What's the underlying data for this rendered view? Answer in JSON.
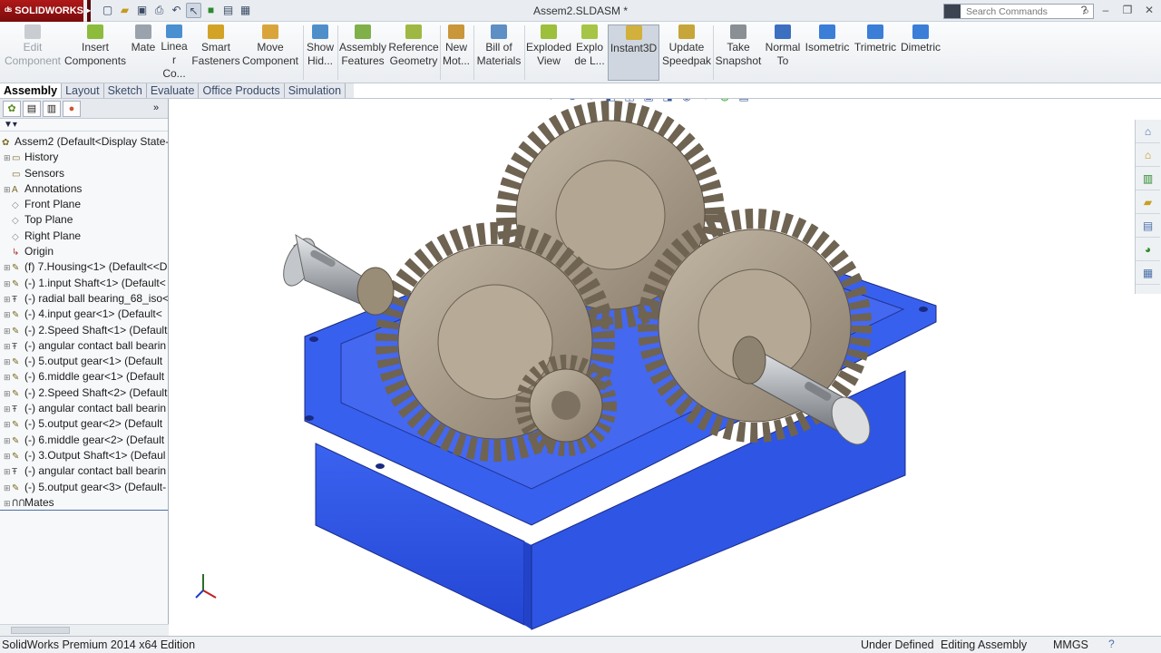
{
  "app": {
    "brand": "SOLIDWORKS",
    "doc_title": "Assem2.SLDASM *"
  },
  "search": {
    "placeholder": "Search Commands"
  },
  "ribbon": {
    "edit_component": [
      "Edit",
      "Component"
    ],
    "insert_components": [
      "Insert",
      "Components"
    ],
    "mate": "Mate",
    "linear_pattern": [
      "Linea",
      "r Co..."
    ],
    "smart_fasteners": [
      "Smart",
      "Fasteners"
    ],
    "move_component": [
      "Move",
      "Component"
    ],
    "show_hidden": [
      "Show",
      "Hid..."
    ],
    "assembly_features": [
      "Assembly",
      "Features"
    ],
    "reference_geometry": [
      "Reference",
      "Geometry"
    ],
    "new_motion": [
      "New",
      "Mot..."
    ],
    "bill_of_materials": [
      "Bill of",
      "Materials"
    ],
    "exploded_view": [
      "Exploded",
      "View"
    ],
    "explode_line": [
      "Explo",
      "de L..."
    ],
    "instant3d": "Instant3D",
    "update_speedpak": [
      "Update",
      "Speedpak"
    ],
    "take_snapshot": [
      "Take",
      "Snapshot"
    ],
    "normal_to": [
      "Normal",
      "To"
    ],
    "isometric": "Isometric",
    "trimetric": "Trimetric",
    "dimetric": "Dimetric"
  },
  "tabs": [
    "Assembly",
    "Layout",
    "Sketch",
    "Evaluate",
    "Office Products",
    "Simulation"
  ],
  "tree": {
    "root": "Assem2  (Default<Display State-",
    "items": [
      "History",
      "Sensors",
      "Annotations",
      "Front Plane",
      "Top Plane",
      "Right Plane",
      "Origin",
      "(f) 7.Housing<1> (Default<<D",
      "(-) 1.input Shaft<1> (Default<",
      "(-) radial ball bearing_68_iso<",
      "(-) 4.input gear<1> (Default<",
      "(-) 2.Speed Shaft<1> (Default",
      "(-) angular contact ball bearin",
      "(-) 5.output gear<1> (Default",
      "(-) 6.middle gear<1> (Default",
      "(-) 2.Speed Shaft<2> (Default",
      "(-) angular contact ball bearin",
      "(-) 5.output gear<2> (Default",
      "(-) 6.middle gear<2> (Default",
      "(-) 3.Output Shaft<1> (Defaul",
      "(-) angular contact ball bearin",
      "(-) 5.output gear<3> (Default-",
      "Mates"
    ]
  },
  "status": {
    "edition": "SolidWorks Premium 2014 x64 Edition",
    "defined": "Under Defined",
    "mode": "Editing Assembly",
    "units": "MMGS"
  },
  "colors": {
    "housing": "#2f55e6",
    "gear": "#a59682",
    "shaft": "#b9bcc0",
    "brand_red": "#b01818"
  }
}
